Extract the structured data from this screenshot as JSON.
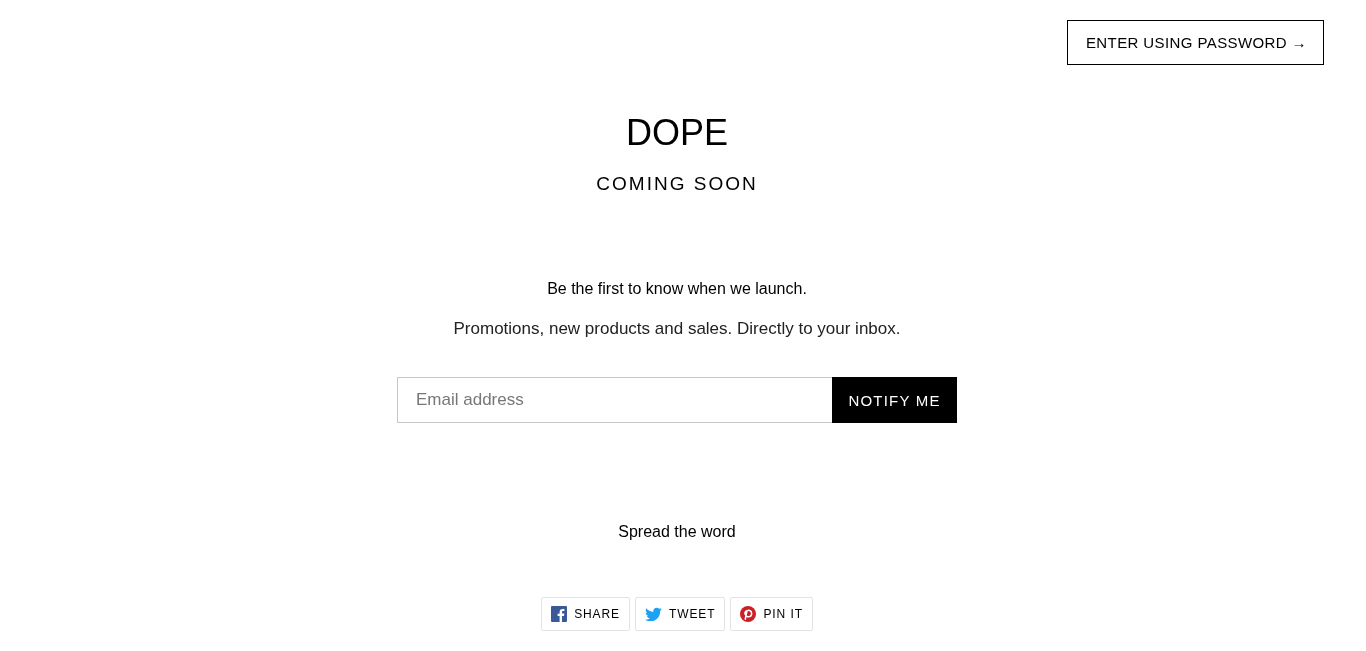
{
  "header": {
    "password_link": "ENTER USING PASSWORD →"
  },
  "hero": {
    "title": "DOPE",
    "subtitle": "COMING SOON"
  },
  "newsletter": {
    "heading": "Be the first to know when we launch.",
    "text": "Promotions, new products and sales. Directly to your inbox.",
    "email": {
      "placeholder": "Email address"
    },
    "button": "NOTIFY ME"
  },
  "share": {
    "heading": "Spread the word",
    "buttons": [
      {
        "kind": "facebook",
        "label": "SHARE"
      },
      {
        "kind": "twitter",
        "label": "TWEET"
      },
      {
        "kind": "pinterest",
        "label": "PIN IT"
      }
    ]
  }
}
